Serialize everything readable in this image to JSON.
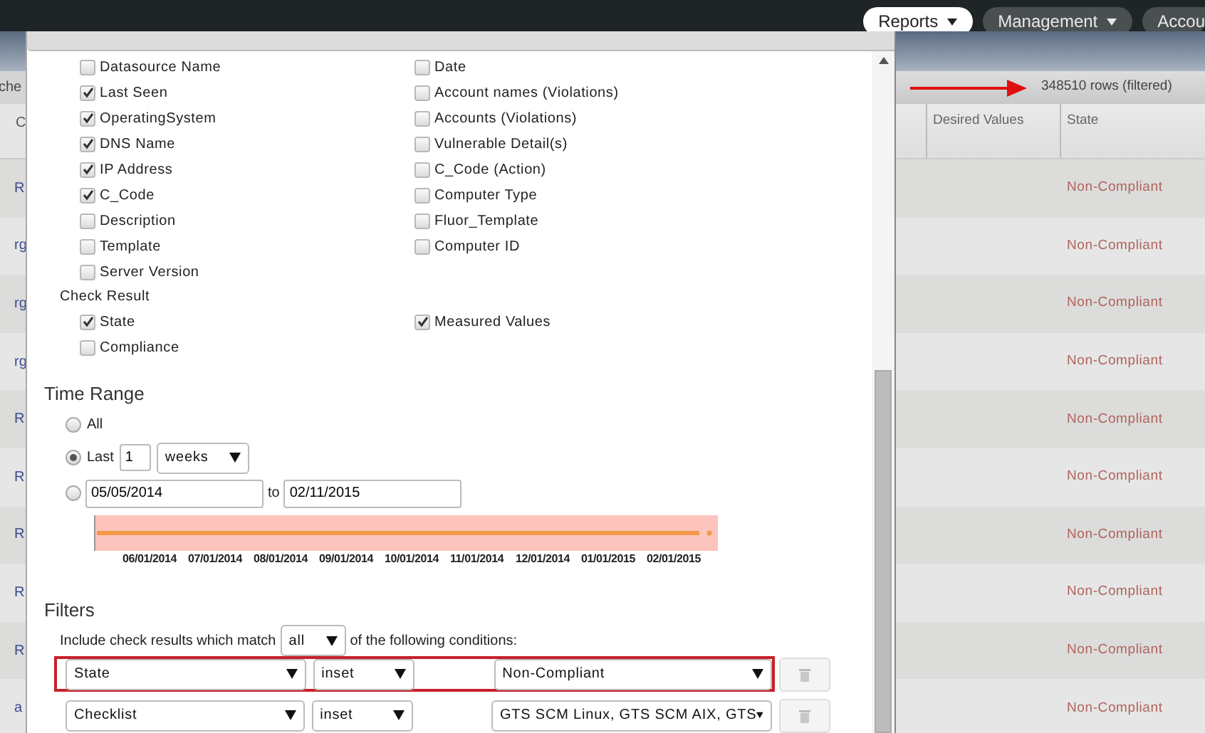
{
  "nav": [
    {
      "label": "Reports",
      "selected": true
    },
    {
      "label": "Management",
      "selected": false
    },
    {
      "label": "Accou",
      "selected": false
    }
  ],
  "background_table": {
    "toolbar_fragment": "che",
    "column_fragment": "C",
    "row_fragments": [
      "R",
      "rg",
      "rg",
      "rg",
      "R",
      "R",
      "R",
      "R",
      "R",
      "a"
    ],
    "row_count": "348510 rows (filtered)",
    "columns": [
      "Desired Values",
      "State"
    ],
    "rows": [
      {
        "state": "Non-Compliant"
      },
      {
        "state": "Non-Compliant"
      },
      {
        "state": "Non-Compliant"
      },
      {
        "state": "Non-Compliant"
      },
      {
        "state": "Non-Compliant"
      },
      {
        "state": "Non-Compliant"
      },
      {
        "state": "Non-Compliant"
      },
      {
        "state": "Non-Compliant"
      },
      {
        "state": "Non-Compliant"
      },
      {
        "state": "Non-Compliant"
      }
    ]
  },
  "dialog": {
    "fields_left": [
      {
        "label": "Datasource Name",
        "checked": false
      },
      {
        "label": "Last Seen",
        "checked": true
      },
      {
        "label": "OperatingSystem",
        "checked": true
      },
      {
        "label": "DNS Name",
        "checked": true
      },
      {
        "label": "IP Address",
        "checked": true
      },
      {
        "label": "C_Code",
        "checked": true
      },
      {
        "label": "Description",
        "checked": false
      },
      {
        "label": "Template",
        "checked": false
      },
      {
        "label": "Server Version",
        "checked": false
      }
    ],
    "fields_right": [
      {
        "label": "Date",
        "checked": false
      },
      {
        "label": "Account names (Violations)",
        "checked": false
      },
      {
        "label": "Accounts (Violations)",
        "checked": false
      },
      {
        "label": "Vulnerable Detail(s)",
        "checked": false
      },
      {
        "label": "C_Code (Action)",
        "checked": false
      },
      {
        "label": "Computer Type",
        "checked": false
      },
      {
        "label": "Fluor_Template",
        "checked": false
      },
      {
        "label": "Computer ID",
        "checked": false
      }
    ],
    "check_result": {
      "title": "Check Result",
      "left": [
        {
          "label": "State",
          "checked": true
        },
        {
          "label": "Compliance",
          "checked": false
        }
      ],
      "right": [
        {
          "label": "Measured Values",
          "checked": true
        }
      ]
    },
    "time_range": {
      "title": "Time Range",
      "options": [
        {
          "kind": "all",
          "label": "All",
          "selected": false
        },
        {
          "kind": "last",
          "label": "Last",
          "selected": true,
          "count": "1",
          "unit": "weeks"
        },
        {
          "kind": "dates",
          "selected": false,
          "from": "05/05/2014",
          "to_label": "to",
          "to": "02/11/2015"
        }
      ],
      "timeline_labels": [
        "06/01/2014",
        "07/01/2014",
        "08/01/2014",
        "09/01/2014",
        "10/01/2014",
        "11/01/2014",
        "12/01/2014",
        "01/01/2015",
        "02/01/2015"
      ]
    },
    "filters": {
      "title": "Filters",
      "intro_before": "Include check results which match",
      "match": "all",
      "intro_after": "of the following conditions:",
      "conditions": [
        {
          "field": "State",
          "operator": "inset",
          "value": "Non-Compliant",
          "highlighted": true
        },
        {
          "field": "Checklist",
          "operator": "inset",
          "value": "GTS SCM Linux, GTS SCM AIX, GTS",
          "highlighted": false
        }
      ]
    }
  }
}
